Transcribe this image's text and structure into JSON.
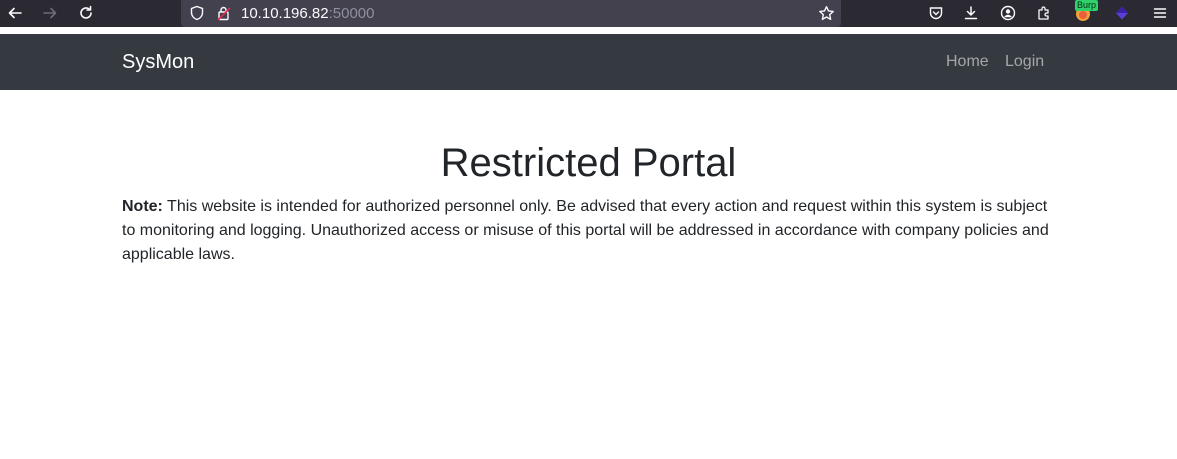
{
  "browser": {
    "url_host": "10.10.196.82",
    "url_port": ":50000",
    "extension_badge": "Burp",
    "icons": [
      "back-icon",
      "forward-icon",
      "reload-icon",
      "shield-icon",
      "lock-icon",
      "bookmark-star-icon",
      "pocket-icon",
      "download-icon",
      "account-icon",
      "extensions-icon",
      "burp-extension-icon",
      "vpn-extension-icon",
      "menu-icon"
    ]
  },
  "navbar": {
    "brand": "SysMon",
    "links": [
      "Home",
      "Login"
    ]
  },
  "main": {
    "title": "Restricted Portal",
    "note_label": "Note:",
    "note_text": " This website is intended for authorized personnel only. Be advised that every action and request within this system is subject to monitoring and logging. Unauthorized access or misuse of this portal will be addressed in accordance with company policies and applicable laws."
  },
  "colors": {
    "toolbar_bg": "#2b2a33",
    "urlbar_bg": "#42414d",
    "navbar_bg": "#343a40",
    "text": "#212529"
  }
}
